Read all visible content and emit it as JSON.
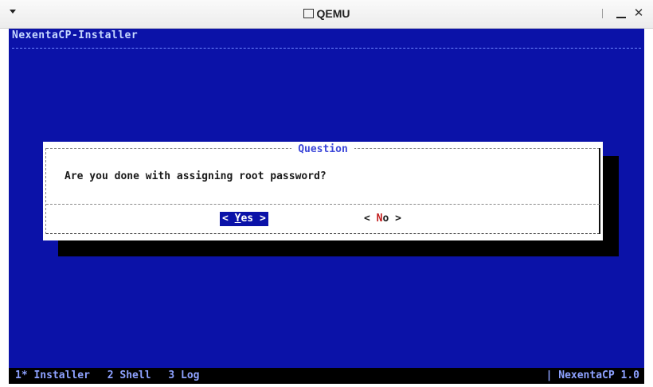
{
  "window": {
    "title": "QEMU",
    "menu_icon": "chevron-down-icon",
    "maximize_icon": "maximize-icon",
    "minimize_icon": "minimize-icon",
    "close_label": "✕"
  },
  "console": {
    "app_title": "NexentaCP-Installer",
    "background_color": "#0b12a8"
  },
  "dialog": {
    "title": "Question",
    "question": "Are you done with assigning root password?",
    "yes": {
      "open": "<",
      "hot": "Y",
      "rest": "es",
      "close": ">"
    },
    "no": {
      "open": "<",
      "hot": "N",
      "rest": "o",
      "close": ">"
    }
  },
  "status": {
    "tabs": [
      "1* Installer",
      "2 Shell",
      "3 Log"
    ],
    "version": "| NexentaCP 1.0"
  }
}
